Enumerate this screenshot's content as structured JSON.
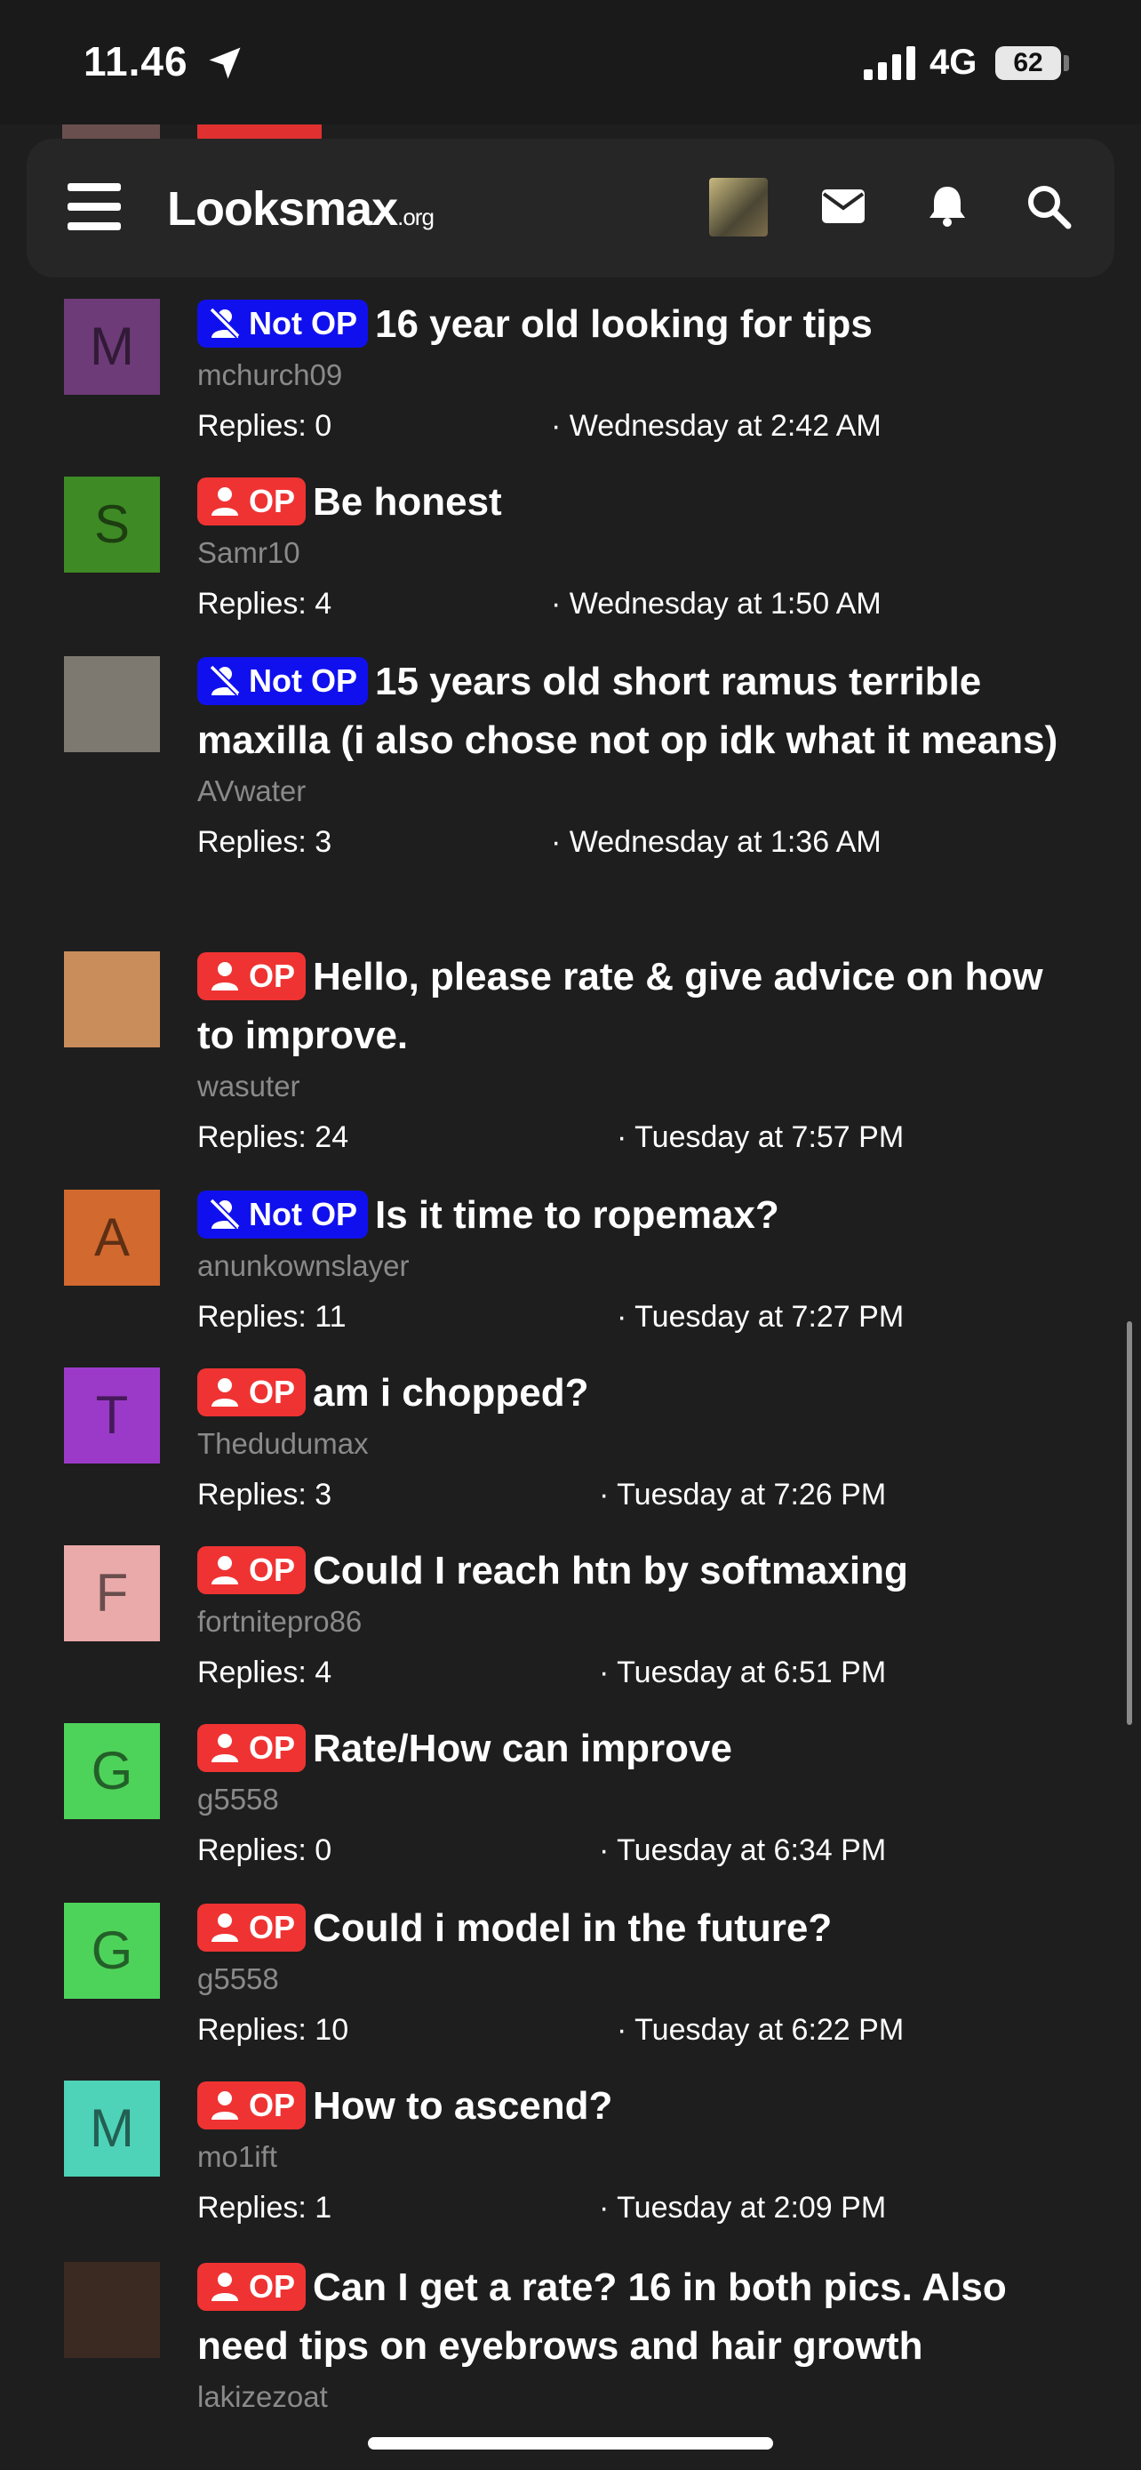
{
  "status_bar": {
    "time": "11.46",
    "network": "4G",
    "battery": "62"
  },
  "header": {
    "logo_main": "Looksmax",
    "logo_suffix": ".org"
  },
  "badges": {
    "op": "OP",
    "not_op": "Not OP"
  },
  "threads": [
    {
      "badge": "not_op",
      "title": "16 year old looking for tips",
      "author": "mchurch09",
      "replies": "Replies: 0",
      "date": "· Wednesday at 2:42 AM",
      "avatar_letter": "M",
      "avatar_color": "#6d3b78"
    },
    {
      "badge": "op",
      "title": "Be honest",
      "author": "Samr10",
      "replies": "Replies: 4",
      "date": "· Wednesday at 1:50 AM",
      "avatar_letter": "S",
      "avatar_color": "#3e8a25"
    },
    {
      "badge": "not_op",
      "title": "15 years old short ramus terrible maxilla (i also chose not op idk what it means)",
      "author": "AVwater",
      "replies": "Replies: 3",
      "date": "· Wednesday at 1:36 AM",
      "avatar_letter": "",
      "avatar_color": "#7d7870"
    },
    {
      "badge": "op",
      "title": "Hello, please rate & give advice on how to improve.",
      "author": "wasuter",
      "replies": "Replies: 24",
      "date": "· Tuesday at 7:57 PM",
      "avatar_letter": "",
      "avatar_color": "#c98d5c"
    },
    {
      "badge": "not_op",
      "title": "Is it time to ropemax?",
      "author": "anunkownslayer",
      "replies": "Replies: 11",
      "date": "· Tuesday at 7:27 PM",
      "avatar_letter": "A",
      "avatar_color": "#d2692e"
    },
    {
      "badge": "op",
      "title": "am i chopped?",
      "author": "Thedudumax",
      "replies": "Replies: 3",
      "date": "· Tuesday at 7:26 PM",
      "avatar_letter": "T",
      "avatar_color": "#9b3ac8"
    },
    {
      "badge": "op",
      "title": "Could I reach htn by softmaxing",
      "author": "fortnitepro86",
      "replies": "Replies: 4",
      "date": "· Tuesday at 6:51 PM",
      "avatar_letter": "F",
      "avatar_color": "#eaaaaa"
    },
    {
      "badge": "op",
      "title": "Rate/How can improve",
      "author": "g5558",
      "replies": "Replies: 0",
      "date": "· Tuesday at 6:34 PM",
      "avatar_letter": "G",
      "avatar_color": "#4ed35a"
    },
    {
      "badge": "op",
      "title": "Could i model in the future?",
      "author": "g5558",
      "replies": "Replies: 10",
      "date": "· Tuesday at 6:22 PM",
      "avatar_letter": "G",
      "avatar_color": "#4ed35a"
    },
    {
      "badge": "op",
      "title": "How to ascend?",
      "author": "mo1ift",
      "replies": "Replies: 1",
      "date": "· Tuesday at 2:09 PM",
      "avatar_letter": "M",
      "avatar_color": "#4ed3b8"
    },
    {
      "badge": "op",
      "title": "Can I get a rate? 16 in both pics. Also need tips on eyebrows and hair growth",
      "author": "lakizezoat",
      "replies": "",
      "date": "",
      "avatar_letter": "",
      "avatar_color": "#3b2a22"
    }
  ]
}
